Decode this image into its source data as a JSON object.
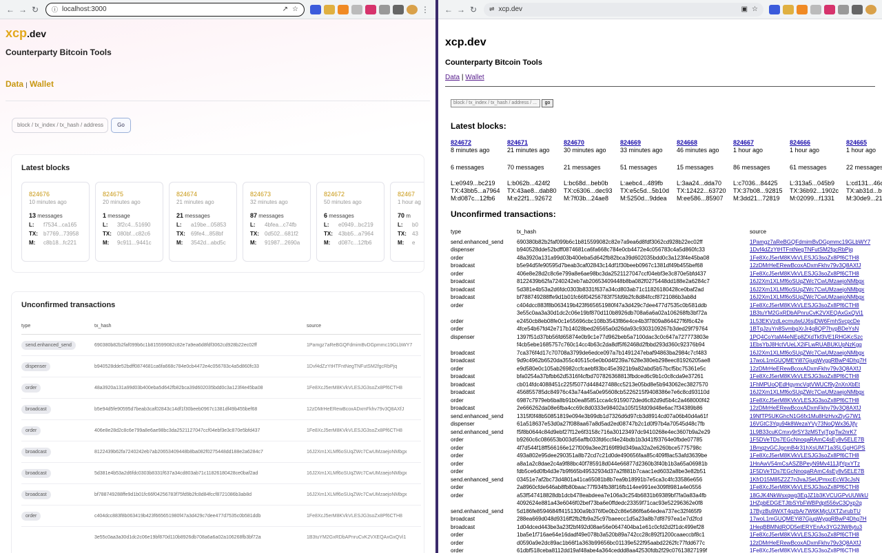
{
  "left": {
    "url": "localhost:3000",
    "logo_main": "xcp",
    "logo_suffix": ".dev",
    "subtitle": "Counterparty Bitcoin Tools",
    "nav": [
      "Data",
      "Wallet"
    ],
    "nav_sep": "|",
    "search_placeholder": "block / tx_index / tx_hash / address",
    "go": "Go",
    "latest_blocks": "Latest blocks",
    "blocks": [
      {
        "height": "824676",
        "time": "10 minutes ago",
        "count": "13",
        "unit": "messages",
        "l": "f7534...ca165",
        "tx": "b7769...73958",
        "m": "c8b18...fc221"
      },
      {
        "height": "824675",
        "time": "20 minutes ago",
        "count": "1",
        "unit": "message",
        "l": "3f2c4...51690",
        "tx": "080bf...c82c6",
        "m": "9c911...9441c"
      },
      {
        "height": "824674",
        "time": "21 minutes ago",
        "count": "21",
        "unit": "messages",
        "l": "a19be...05853",
        "tx": "69fe4...858bf",
        "m": "3542d...abd5c"
      },
      {
        "height": "824673",
        "time": "32 minutes ago",
        "count": "87",
        "unit": "messages",
        "l": "4bfea...c74fb",
        "tx": "0d502...681f2",
        "m": "91987...2690a"
      },
      {
        "height": "824672",
        "time": "50 minutes ago",
        "count": "6",
        "unit": "messages",
        "l": "e0949...bc219",
        "tx": "43bb5...a7964",
        "m": "d087c...12fb6"
      },
      {
        "height": "82467",
        "time": "1 hour ag",
        "count": "70",
        "unit": "m",
        "l": "b0",
        "tx": "43",
        "m": "e"
      }
    ],
    "unconfirmed": "Unconfirmed transactions",
    "cols": [
      "type",
      "tx_hash",
      "source"
    ],
    "rows": [
      [
        "send.enhanced_send",
        "690380b82b2faf099b6c1b815599082c82e7a9ea6d8fdf3062cd928b22ec02ff",
        "1Pamgz7aReBGQFdmimBvDGpmmc19GLbWY7"
      ],
      [
        "dispenser",
        "b940528dde52bdff0874681ca6fa668c784e0cb4472e4c056783c4a5d860fc33",
        "1Dvf4dZzYtHTFntNegTNFutSM2fgcRbPjq"
      ],
      [
        "order",
        "48a3920a131a99d03b400eba5d642fb82bca39d602035bdd0c3a123f4e45ba08",
        "1Fe8XcJ5erM8KVkVLESJG3soZx8Pf6CTH8"
      ],
      [
        "broadcast",
        "b5e94d5fe90595d7beab3caf02843c14df1f30beeb0967c1381df49b455bef68",
        "12zDMrHeERewBcoxADxmFkhv79v3Q8AXfJ"
      ],
      [
        "order",
        "406e8e28d2c8c6e799a8e6ae98bc3da2521127047ccf04ebf3e3c870e5bfd437",
        "1Fe8XcJ5erM8KVkVLESJG3soZx8Pf6CTH8"
      ],
      [
        "broadcast",
        "8122439b62fa7240242eb7ab20653409448b8ba082f0275448dd188e2a6284c7",
        "16J2Xm1XLMf6oSUqZWc7CwUMzaejoNMbgx"
      ],
      [
        "broadcast",
        "5d381e4b53a2d6fdc0303b8331f637a34cd803ab71c11826180428ce0baf2ad",
        "16J2Xm1XLMf6oSUqZWc7CwUMzaejoNMbgx"
      ],
      [
        "broadcast",
        "bf788749288ffe9d1b01fc66f04256783f75fd9b2fc8d84fccf8721086b3ab8d",
        "16J2Xm1XLMf6oSUqZWc7CwUMzaejoNMbgx"
      ],
      [
        "order",
        "c404dcc883f8b063419b423f665651980f47a3d429c7dee477d7535c0b581ddb",
        "1Fe8XcJ5erM8KVkVLESJG3soZx8Pf6CTH8"
      ],
      [
        "",
        "3e55c0aa3a30d1dc2c06e19bf870d110b8926db708a6a6a02a106268fb3bf72a",
        "1B3tuYM2GxRDbAPnruCvK2VXEQAxGxQVi1"
      ]
    ]
  },
  "right": {
    "url": "xcp.dev",
    "title": "xcp.dev",
    "subtitle": "Counterparty Bitcoin Tools",
    "nav": [
      "Data",
      "Wallet"
    ],
    "nav_sep": "|",
    "search_placeholder": "block / tx_index / tx_hash / address / ...",
    "go": "go",
    "latest_blocks": "Latest blocks:",
    "blocks": [
      {
        "height": "824672",
        "time": "8 minutes ago",
        "msgs": "6 messages",
        "l": "L:e0949...bc219",
        "tx": "TX:43bb5...a7964",
        "m": "M:d087c...12fb6"
      },
      {
        "height": "824671",
        "time": "21 minutes ago",
        "msgs": "70 messages",
        "l": "L:b062b...424f2",
        "tx": "TX:43ae8...dab80",
        "m": "M:e22f1...92672"
      },
      {
        "height": "824670",
        "time": "30 minutes ago",
        "msgs": "21 messages",
        "l": "L:bc68d...beb0b",
        "tx": "TX:c6306...dec93",
        "m": "M:7f03b...24ae8"
      },
      {
        "height": "824669",
        "time": "33 minutes ago",
        "msgs": "51 messages",
        "l": "L:aebc4...489fb",
        "tx": "TX:e5c5d...5b10d",
        "m": "M:5250d...9ddea"
      },
      {
        "height": "824668",
        "time": "46 minutes ago",
        "msgs": "15 messages",
        "l": "L:3aa24...dda70",
        "tx": "TX:12422...63720",
        "m": "M:ee586...85907"
      },
      {
        "height": "824667",
        "time": "1 hour ago",
        "msgs": "86 messages",
        "l": "L:c7036...84425",
        "tx": "TX:37b08...92815",
        "m": "M:3dd21...72819"
      },
      {
        "height": "824666",
        "time": "1 hour ago",
        "msgs": "61 messages",
        "l": "L:313a5...045b9",
        "tx": "TX:36b92...1902c",
        "m": "M:02099...f1331"
      },
      {
        "height": "824665",
        "time": "1 hour ago",
        "msgs": "22 messages",
        "l": "L:cd131...46c",
        "tx": "TX:ab31d...b0",
        "m": "M:30de9...21"
      }
    ],
    "unconfirmed": "Unconfirmed transactions:",
    "cols": [
      "type",
      "tx_hash",
      "source"
    ],
    "rows": [
      [
        "send.enhanced_send",
        "690380b82b2faf099b6c1b815599082c82e7a9ea6d8fdf3062cd928b22ec02ff",
        "1Pamgz7aReBGQFdmimBvDGpmmc19GLbWY7"
      ],
      [
        "dispenser",
        "b940528dde52bdff0874681ca6fa668c784e0cb4472e4c056783c4a5d860fc33",
        "1Dvf4dZzYtHTFntNegTNFutSM2fgcRbPjq"
      ],
      [
        "order",
        "48a3920a131a99d03b400eba5d642fb82bca39d602035bdd0c3a123f4e45ba08",
        "1Fe8XcJ5erM8KVkVLESJG3soZx8Pf6CTH8"
      ],
      [
        "broadcast",
        "b5e94d5fe90595d7beab3caf02843c14df1f30beeb0967c1381df49b455bef68",
        "12zDMrHeERewBcoxADxmFkhv79v3Q8AXfJ"
      ],
      [
        "order",
        "406e8e28d2c8c6e799a8e6ae98bc3da2521127047ccf04ebf3e3c870e5bfd437",
        "1Fe8XcJ5erM8KVkVLESJG3soZx8Pf6CTH8"
      ],
      [
        "broadcast",
        "8122439b62fa7240242eb7ab20653409448b8ba082f0275448dd188e2a6284c7",
        "16J2Xm1XLMf6oSUqZWc7CwUMzaejoNMbgx"
      ],
      [
        "broadcast",
        "5d381e4b53a2d6fdc0303b8331f637a34cd803ab71c11826180428ce0baf2ad",
        "16J2Xm1XLMf6oSUqZWc7CwUMzaejoNMbgx"
      ],
      [
        "broadcast",
        "bf788749288ffe9d1b01fc66f04256783f75fd9b2fc8d84fccf8721086b3ab8d",
        "16J2Xm1XLMf6oSUqZWc7CwUMzaejoNMbgx"
      ],
      [
        "order",
        "c404dcc883f8b063419b423f665651980f47a3d429c7dee477d7535c0b581ddb",
        "1Fe8XcJ5erM8KVkVLESJG3soZx8Pf6CTH8"
      ],
      [
        "",
        "3e55c0aa3a30d1dc2c06e19bf870d110b8926db708a6a6a02a106268fb3bf72a",
        "1B3tuYM2GxRDbAPnruCvK2VXEQAxGxQVi1"
      ],
      [
        "order",
        "e2450cb8eb08fe0c1e55696cbc108b3543f86e4ce4b3f7809a864427f6f6c42e",
        "1L53EKVzdLecmutwUJ6sjDW6FmhSvcpcDe"
      ],
      [
        "order",
        "4fce54b67fd42e717b14028bed26565a0d26da93c9303109267b3ded29f79764",
        "1BTqJzuYn8SvmbgXrJr4g8QP7hypBDeYsN"
      ],
      [
        "dispenser",
        "1397f51d37bb56fd65874e0b9c1e77d962beb5a7100dac3c0c647a727773803e",
        "1PQ4CoYtaM4eNEp8ZXdTkf3VE1RHGKcSzc"
      ],
      [
        "",
        "f4cb5ebe1685757c760c14cc4b63c2da8df5f62468d2fbbd293d360c92376b94",
        "1EbsYbJ8HctVUeLX2iFLwRUABUKUpNzKgg"
      ],
      [
        "broadcast",
        "7ca376f4d17c70708a3799de6edce097a7b1491247ebaf94863ba2984c7cf483",
        "16J2Xm1XLMf6oSUqZWc7CwUMzaejoNMbgx"
      ],
      [
        "broadcast",
        "9d9c4962b6520da355c40515c6e0b0d4f239a7628e380eb298eec81926205ae8",
        "17woL1mGUQMEYi87GjugWyggRBwP4Dhg7H"
      ],
      [
        "order",
        "e9d580e0c105ab26982ccfcaebf83bc45e3921b9a82abd5b57bcf5bc75361e5c",
        "12zDMrHeERewBcoxADxmFkhv79v3Q8AXfJ"
      ],
      [
        "broadcast",
        "bfa0254a37bfbb62d5316f4cfbd707826368813fbdced6c9b1c0c8cda9e37261",
        "1Fe8XcJ5erM8KVkVLESJG3soZx8Pf6CTH8"
      ],
      [
        "broadcast",
        "cb014fdc4088451c225f5077d448427488cc5213e05bd8e5b943062ec3827570",
        "1FhMPUoQEdHgymcVqtVWUCf9y2nXnXbEt"
      ],
      [
        "broadcast",
        "456855785dc84976c43a74a45a0e95608cb5226215f9408386e7e6c8cd93110d",
        "16J2Xm1XLMf6oSUqZWc7CwUMzaejoNMbgx"
      ],
      [
        "order",
        "6987c7979eb6ba8b91b0ea85851cca4c9159072ded6c82d9d5b4c2a468000f42",
        "1Fe8XcJ5erM8KVkVLESJG3soZx8Pf6CTH8"
      ],
      [
        "broadcast",
        "2e666262da08e6fba4cc69c8d0333e98402a105f15fd09d48e6ac7f34389b86",
        "12zDMrHeERewBcoxADxmFkhv79v3Q8AXfJ"
      ],
      [
        "send.enhanced_send",
        "1315f0f48b50851819e094e3b99db1d7326d6d97cb3d8914cd07a06b40d4a61f",
        "19NfTP5UKGhcN1G6fx1Mu8HzHvxZlyG7W1"
      ],
      [
        "dispenser",
        "61a518637e53d0a27f088aa67a8d5ad2ed08747b2c1d0f97b4a70545d48c7fb",
        "16VGtC3Yqu94k8WezaYVy73NoQWx36Jjfy"
      ],
      [
        "send.enhanced_send",
        "f5f8b0644c84d9ebf27f12e6f3158c716a30123497dc9410268e4ec3607b9a2e29",
        "1L9B33cuKCmxy9rSY3zM5TvjTpqTw2nrK7"
      ],
      [
        "order",
        "b9260c6c086653b003d56affb033fd6ccf4e24bdb1b3d41f93764e0fbde07785",
        "1F5DVeTDs7EGcNnoqaRAmC4sEy8v5ELE7B"
      ],
      [
        "order",
        "4f7d544f18ff566166e127f009a3ee2f169f89d349aa32a2e6260bce5775798c",
        "1BmqzvGCJgcmB4r31hXsUM71a35LGgHGPS"
      ],
      [
        "order",
        "493a802e95dee290351a8b72cd7c21d0de490656faa85c409f8ac53afd3639be",
        "1Fe8XcJ5erM8KVkVLESJG3soZx8Pf6CTH8"
      ],
      [
        "order",
        "a8a1a2c8dae2c4a9f88bc40f785918d044e66877d2360b3f40b1b3a65a06981b",
        "1HnAwV54mCsASZBPeyN9Mv411JjfYpxYTz"
      ],
      [
        "order",
        "fdb5ce6d0fb4d3e7b9f665b49532934d37a2f881b7caac1ed6032a8be3e82b51",
        "1F5DVeTDs7EGcNnoqaRAmC4sEy8v5ELE7B"
      ],
      [
        "send.enhanced_send",
        "03451e7af2bc73d4801a41ca65081b8b7ea9b18991b7e5ca3c4fc33586e656",
        "1KfrD15M85Z2Z7n3vaJSeUPmxcEcW3cJsN"
      ],
      [
        "order",
        "2a8960cfde646ab8fb80baac77f934fb38f16fb114ee991ee309f8981a4e0556",
        "1Fe8XcJ5erM8KVkVLESJG3soZx8Pf6CTH8"
      ],
      [
        "order",
        "a53f547418828db1dcb478eabdeea7e106a3c254b6831b69389bf7fa0a83a4fb",
        "18GJK4NkWsxqwg3EqJZ1b3KVCUGPvUUWkU"
      ],
      [
        "",
        "4092624e881a43e6046f02bef73ba6e0ffdedc23359f71cac93e52296362e0f8",
        "1HZpbEDGETJtbSYbFWBPdpt556vC3Qxp2q"
      ],
      [
        "send.enhanced_send",
        "5d186fe8594684ff4151300a9b376f0e0b2c86e586f6a64edea737ec32f465f9",
        "17ByzBu9WXT4qzbAr7W6KMjcUXTZvrubTU"
      ],
      [
        "broadcast",
        "288ea669d048d9316ff2fb2fb9a25c97baeecc1d5a23a8b7df8797ea1e7d2fcd",
        "17woL1mGUQMEYi87GjugWyggRBwP4Dhg7H"
      ],
      [
        "broadcast",
        "1d04dced443be3a23f2bf492d08ae56e0647404ba1e61c0cfd2d2f1dc499ef28",
        "1HeqBBMNdRQD5etERYEnAx3YG23W8ytu3"
      ],
      [
        "order",
        "1ba5e1f716ae64e16dadf49e078b3a520b89a742cc28c892f1200caaeccbf8c1",
        "1Fe8XcJ5erM8KVkVLESJG3soZx8Pf6CTH8"
      ],
      [
        "order",
        "d0590a9e2dc89ac1b66f1a363b99656bc01139e522f95aabd2262fc77fdd677c",
        "12zDMrHeERewBcoxADxmFkhv79v3Q8AXfJ"
      ],
      [
        "order",
        "61dbf518ceba8112dd19af48abe4a364ceddd8aa42530fdb2f29c07613827199f",
        "1Fe8XcJ5erM8KVkVLESJG3soZx8Pf6CTH8"
      ],
      [
        "order",
        "8ef29482762f5302bdc1b99018ca569ee3acb422d9eea7934a7fe093f3481324",
        "1Fe8XcJ5erM8KVkVLESJG3soZx8Pf6CTH8"
      ]
    ]
  }
}
